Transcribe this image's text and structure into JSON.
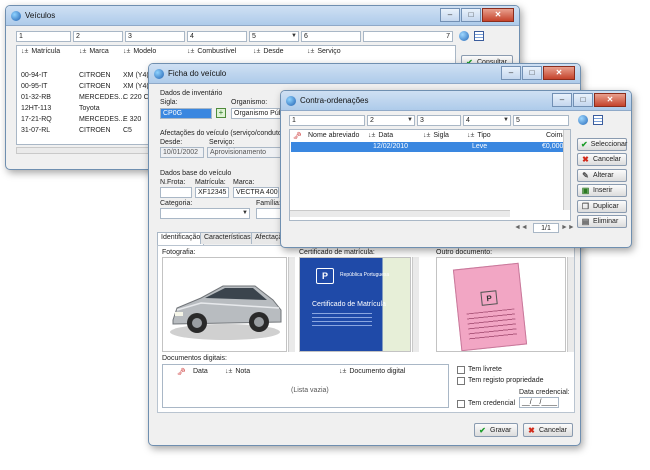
{
  "veiculos": {
    "title": "Veículos",
    "filters": [
      "1",
      "2",
      "3",
      "4",
      "5",
      "6",
      "7"
    ],
    "columns": [
      "Matrícula",
      "Marca",
      "Modelo",
      "Combustível",
      "Desde",
      "Serviço"
    ],
    "rows": [
      {
        "matricula": "00-94-IT",
        "marca": "CITROEN",
        "modelo": "XM (Y4("
      },
      {
        "matricula": "00-95-IT",
        "marca": "CITROEN",
        "modelo": "XM (Y4("
      },
      {
        "matricula": "01-32-RB",
        "marca": "MERCEDES...",
        "modelo": "C 220 CI"
      },
      {
        "matricula": "12HT-113",
        "marca": "Toyota",
        "modelo": ""
      },
      {
        "matricula": "17-21-RQ",
        "marca": "MERCEDES...",
        "modelo": "E 320"
      },
      {
        "matricula": "31-07-RL",
        "marca": "CITROEN",
        "modelo": "C5"
      }
    ],
    "consultar_label": "Consultar"
  },
  "ficha": {
    "title": "Ficha do veículo",
    "dados_inventario": "Dados de inventário",
    "sigla_label": "Sigla:",
    "sigla_value": "CP0G",
    "organismo_label": "Organismo:",
    "organismo_value": "Organismo Públic",
    "afectacoes_label": "Afectações do veículo (serviço/condutor)",
    "desde_label": "Desde:",
    "desde_value": "10/01/2002",
    "servico_label": "Serviço:",
    "servico_value": "Aprovisionamento",
    "dados_base": "Dados base do veículo",
    "nfrota_label": "N.Frota:",
    "matricula_label": "Matrícula:",
    "matricula_value": "XF12345",
    "marca_label": "Marca:",
    "marca_value": "VECTRA 400",
    "categoria_label": "Categoria:",
    "familia_label": "Família:",
    "tabs": [
      "Identificação",
      "Características",
      "Afectação"
    ],
    "fotografia_label": "Fotografia:",
    "certificado_label": "Certificado de matrícula:",
    "outro_label": "Outro documento:",
    "cert_card": {
      "line1": "República Portuguesa",
      "title": "Certificado de Matrícula"
    },
    "doc_label": "Documentos digitais:",
    "doc_columns": [
      "Data",
      "Nota",
      "Documento digital"
    ],
    "doc_empty": "(Lista vazia)",
    "tem_livrete": "Tem livrete",
    "tem_registo": "Tem registo propriedade",
    "tem_credencial": "Tem credencial",
    "data_credencial_label": "Data credencial:",
    "data_credencial_value": "__/__/____",
    "gravar_label": "Gravar",
    "cancelar_label": "Cancelar"
  },
  "contra": {
    "title": "Contra-ordenações",
    "filters": [
      "1",
      "2",
      "3",
      "4",
      "5"
    ],
    "columns": [
      "Nome abreviado",
      "Data",
      "Sigla",
      "Tipo",
      "Coima"
    ],
    "row": {
      "nome": "",
      "data": "12/02/2010",
      "sigla": "",
      "tipo": "Leve",
      "coima": "€0,0000"
    },
    "pager": "1/1",
    "buttons": [
      "Seleccionar",
      "Cancelar",
      "Alterar",
      "Inserir",
      "Duplicar",
      "Eliminar"
    ]
  },
  "colors": {
    "selected_row": "#3a87e0",
    "title_gradient": "#aecbea"
  }
}
